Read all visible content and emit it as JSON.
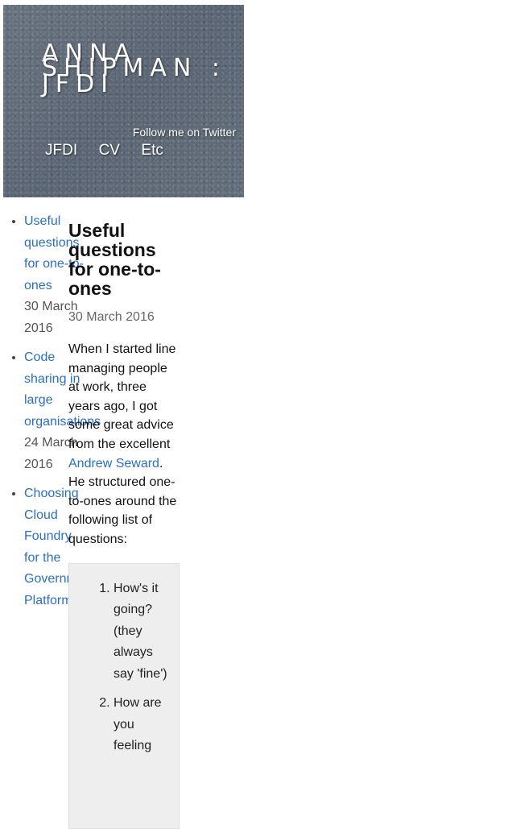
{
  "header": {
    "logo_lines": [
      "ANNA",
      "SHIPMAN :",
      "JFDI"
    ],
    "twitter_label": "Follow me on Twitter",
    "nav": [
      "JFDI",
      "CV",
      "Etc"
    ]
  },
  "sidebar": {
    "posts": [
      {
        "title": "Useful questions for one-to-ones",
        "date": "30 March 2016"
      },
      {
        "title": "Code sharing in large organisations",
        "date": "24 March 2016"
      },
      {
        "title": "Choosing Cloud Foundry for the Government Platform",
        "date": ""
      }
    ]
  },
  "article": {
    "title": "Useful questions for one-to-ones",
    "date": "30 March 2016",
    "intro_before_link": "When I started line managing people at work, three years ago, I got some great advice from the excellent ",
    "intro_link": "Andrew Seward",
    "intro_after_link": ". He structured one-to-ones around the following list of questions:",
    "questions": [
      "How's it going? (they always say 'fine')",
      "How are you feeling"
    ]
  },
  "colors": {
    "link": "#2a6fc4",
    "header_bg": "#5f6a78",
    "box_bg": "#eeeeee"
  }
}
